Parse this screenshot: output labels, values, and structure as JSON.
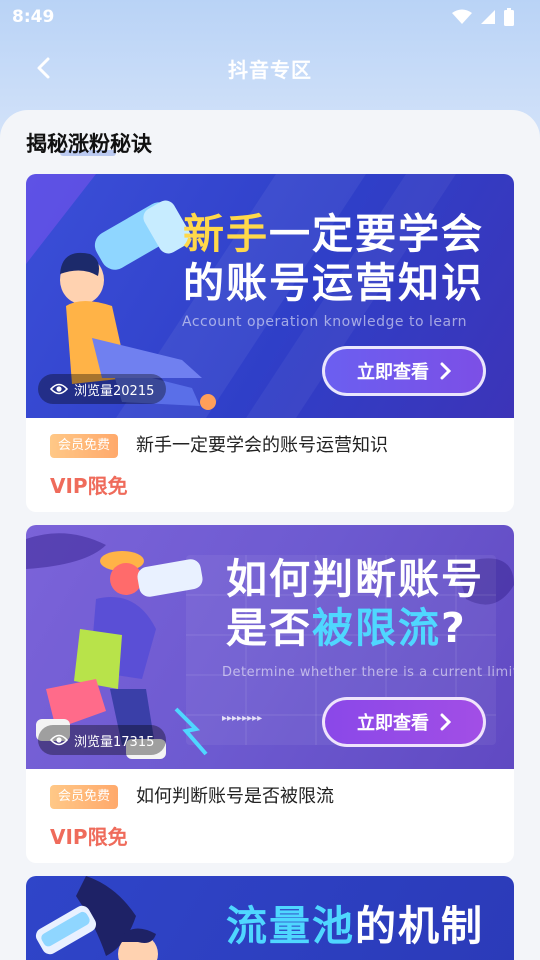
{
  "status": {
    "time": "8:49"
  },
  "nav": {
    "title": "抖音专区"
  },
  "section": {
    "title": "揭秘涨粉秘诀"
  },
  "cards": [
    {
      "headline_1a": "新手",
      "headline_1b": "一定要学会",
      "headline_2": "的账号运营知识",
      "subtitle": "Account operation knowledge to learn",
      "cta": "立即查看",
      "views": "浏览量20215",
      "tag": "会员免费",
      "title": "新手一定要学会的账号运营知识",
      "price": "VIP限免"
    },
    {
      "headline_1": "如何判断账号",
      "headline_2a": "是否",
      "headline_2b": "被限流",
      "headline_2c": "?",
      "subtitle": "Determine whether there is a current limit",
      "cta": "立即查看",
      "views": "浏览量17315",
      "tag": "会员免费",
      "title": "如何判断账号是否被限流",
      "price": "VIP限免"
    },
    {
      "headline_1a": "流量池",
      "headline_1b": "的机制"
    }
  ]
}
